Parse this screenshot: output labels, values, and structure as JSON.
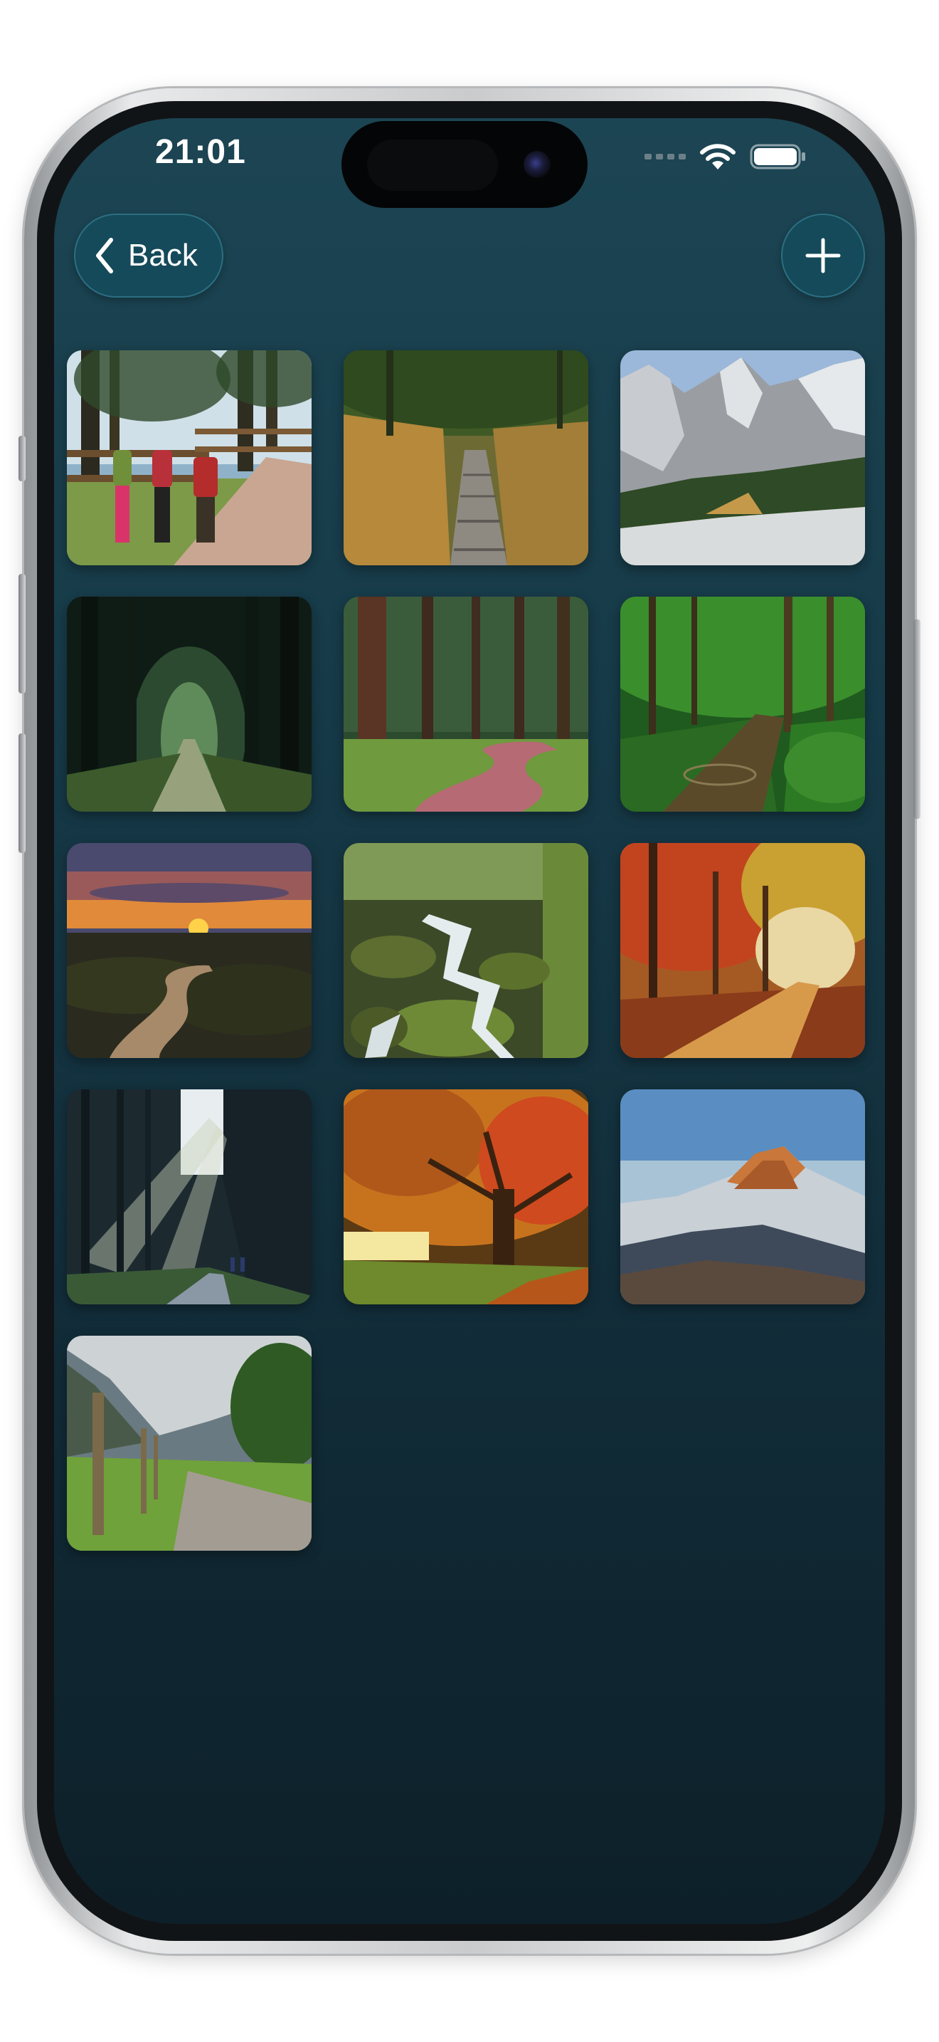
{
  "status_bar": {
    "time": "21:01"
  },
  "nav": {
    "back_label": "Back",
    "back_icon": "chevron-left-icon",
    "add_icon": "plus-icon"
  },
  "colors": {
    "background_top": "#1c4553",
    "background_bottom": "#0d2029",
    "button_fill": "#154a5a",
    "button_border": "#2b6f82",
    "accent": "#ffffff"
  },
  "photos": [
    {
      "name": "hikers-on-trail"
    },
    {
      "name": "boardwalk-through-grass"
    },
    {
      "name": "alpine-mountain-valley"
    },
    {
      "name": "dark-forest-tunnel"
    },
    {
      "name": "pine-forest-path"
    },
    {
      "name": "green-forest-stream"
    },
    {
      "name": "sunset-over-hills"
    },
    {
      "name": "mossy-waterfall-creek"
    },
    {
      "name": "autumn-forest-path"
    },
    {
      "name": "sunbeams-in-forest"
    },
    {
      "name": "autumn-tree-in-meadow"
    },
    {
      "name": "snowy-mountain-peak"
    },
    {
      "name": "gravel-road-by-fence"
    }
  ]
}
